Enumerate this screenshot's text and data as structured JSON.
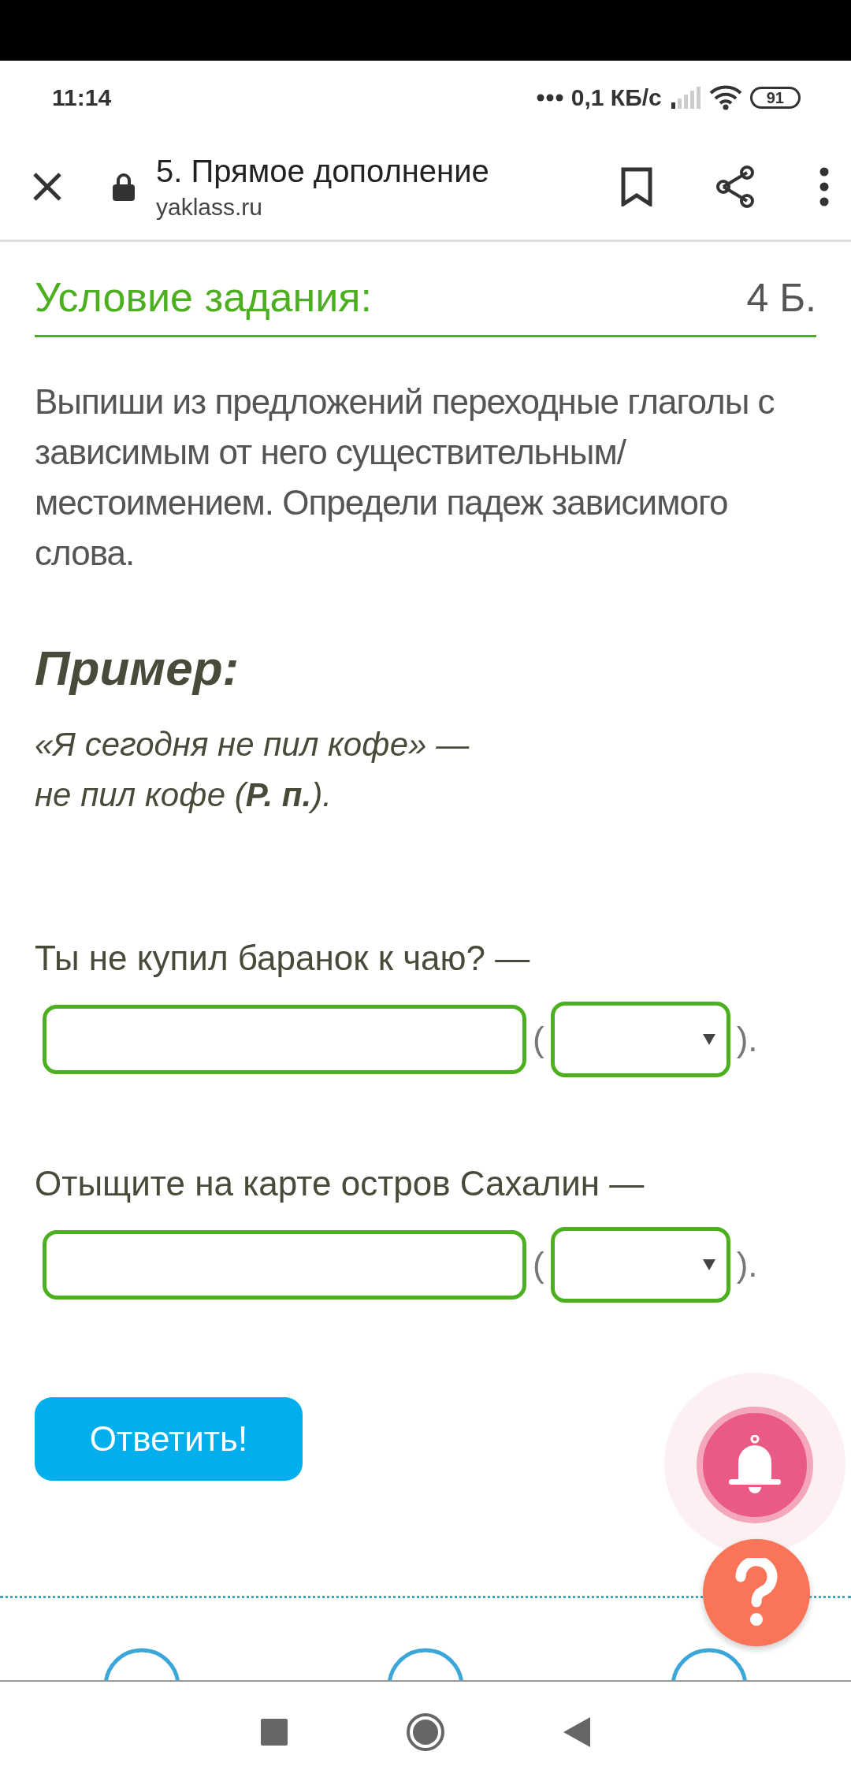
{
  "status_bar": {
    "time": "11:14",
    "network_speed": "0,1 КБ/с",
    "battery": "91"
  },
  "header": {
    "title": "5. Прямое дополнение",
    "url": "yaklass.ru"
  },
  "task": {
    "heading": "Условие задания:",
    "points": "4 Б.",
    "text": "Выпиши из предложений переходные глаголы с зависимым от него существительным/местоимением. Определи падеж зависимого слова."
  },
  "example": {
    "heading": "Пример:",
    "lines": [
      "«Я сегодня не пил кофе» —",
      "не пил кофе (**Р. п.**)."
    ]
  },
  "questions": [
    {
      "prompt": "Ты не купил баранок к чаю? —",
      "open_paren": "(",
      "close_paren": ")."
    },
    {
      "prompt": "Отыщите на карте остров Сахалин —",
      "open_paren": "(",
      "close_paren": ")."
    }
  ],
  "submit_button": "Ответить!"
}
